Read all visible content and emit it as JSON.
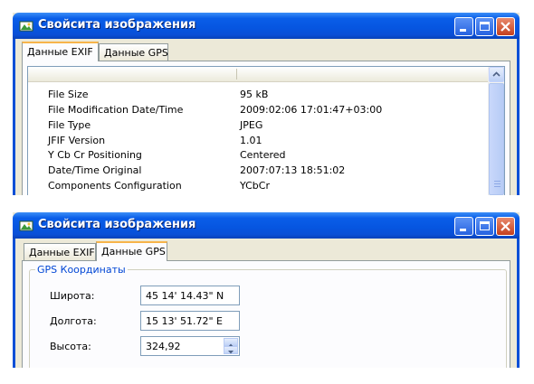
{
  "window_exif": {
    "title": "Свойсита изображения",
    "tabs": [
      "Данные EXIF",
      "Данные GPS"
    ],
    "active_tab": "Данные EXIF",
    "rows": [
      {
        "key": "File Size",
        "value": "95 kB"
      },
      {
        "key": "File Modification Date/Time",
        "value": "2009:02:06 17:01:47+03:00"
      },
      {
        "key": "File Type",
        "value": "JPEG"
      },
      {
        "key": "JFIF Version",
        "value": "1.01"
      },
      {
        "key": "Y Cb Cr Positioning",
        "value": "Centered"
      },
      {
        "key": "Date/Time Original",
        "value": "2007:07:13 18:51:02"
      },
      {
        "key": "Components Configuration",
        "value": "YCbCr"
      }
    ]
  },
  "window_gps": {
    "title": "Свойсита изображения",
    "tabs": [
      "Данные EXIF",
      "Данные GPS"
    ],
    "active_tab": "Данные GPS",
    "group_label": "GPS Координаты",
    "latitude_label": "Широта:",
    "latitude_value": "45 14' 14.43\" N",
    "longitude_label": "Долгота:",
    "longitude_value": "15 13' 51.72\" E",
    "altitude_label": "Высота:",
    "altitude_value": "324,92"
  },
  "icons": [
    "app-icon",
    "minimize-icon",
    "maximize-icon",
    "close-icon",
    "scroll-up-icon",
    "spin-up-icon",
    "spin-down-icon"
  ],
  "colors": {
    "titlebar": "#0a5ee8",
    "dialog": "#ece9d8",
    "active_tab_accent": "#f7b44a",
    "group_label": "#0046d5",
    "close_button": "#c4401f"
  }
}
